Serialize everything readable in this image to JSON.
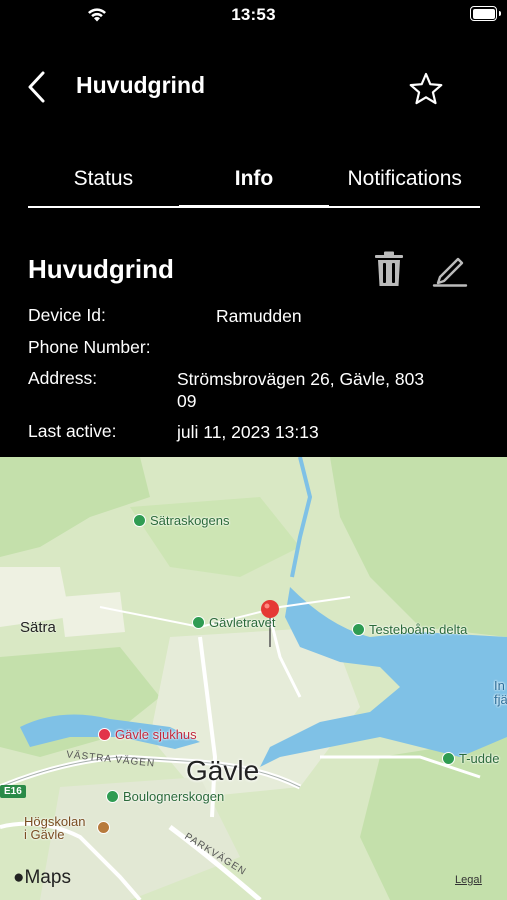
{
  "status_bar": {
    "time": "13:53"
  },
  "nav": {
    "title": "Huvudgrind"
  },
  "tabs": [
    {
      "label": "Status",
      "active": false
    },
    {
      "label": "Info",
      "active": true
    },
    {
      "label": "Notifications",
      "active": false
    }
  ],
  "device": {
    "title": "Huvudgrind",
    "fields": {
      "device_id_label": "Device Id:",
      "device_id_value": "Ramudden",
      "phone_label": "Phone Number:",
      "phone_value": "",
      "address_label": "Address:",
      "address_value": "Strömsbrovägen 26, Gävle, 803 09",
      "last_active_label": "Last active:",
      "last_active_value": "juli 11, 2023 13:13"
    }
  },
  "map": {
    "labels": {
      "satraskogens": "Sätraskogens",
      "gavletravet": "Gävletravet",
      "testeboans": "Testeboåns delta",
      "satra": "Sätra",
      "gavle_sjukhus": "Gävle sjukhus",
      "vastra_vagen": "VÄSTRA VÄGEN",
      "gavle": "Gävle",
      "t_udde": "T-udde",
      "e16": "E16",
      "boulognerskogen": "Boulognerskogen",
      "hogskolan_1": "Högskolan",
      "hogskolan_2": "i Gävle",
      "parkvagen": "PARKVÄGEN",
      "water_1": "In",
      "water_2": "fjär"
    },
    "attribution": "Maps",
    "legal": "Legal",
    "colors": {
      "land": "#d9e8c4",
      "water": "#7fc1e6",
      "park": "#b9dc9c",
      "pin": "#e53935"
    }
  }
}
